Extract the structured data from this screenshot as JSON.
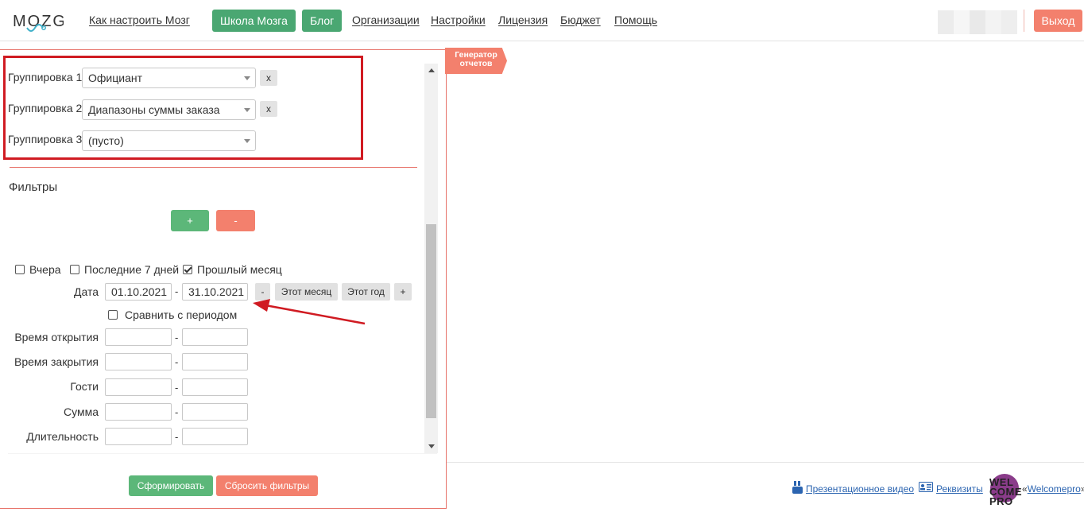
{
  "header": {
    "logo_text": "MOZG",
    "nav_links": [
      "Как настроить Мозг",
      "Организации",
      "Настройки",
      "Лицензия",
      "Бюджет",
      "Помощь"
    ],
    "nav_buttons": [
      "Школа Мозга",
      "Блог"
    ],
    "logout_label": "Выход"
  },
  "panel": {
    "tab_label_line1": "Генератор",
    "tab_label_line2": "отчетов",
    "groupings": [
      {
        "label": "Группировка 1",
        "value": "Официант",
        "remove": "x"
      },
      {
        "label": "Группировка 2",
        "value": "Диапазоны суммы заказа",
        "remove": "x"
      },
      {
        "label": "Группировка 3",
        "value": "(пусто)"
      }
    ],
    "filters_title": "Фильтры",
    "add_filter": "+",
    "remove_filter": "-",
    "quick_periods": [
      {
        "label": "Вчера",
        "checked": false
      },
      {
        "label": "Последние 7 дней",
        "checked": false
      },
      {
        "label": "Прошлый месяц",
        "checked": true
      }
    ],
    "date": {
      "label": "Дата",
      "from": "01.10.2021",
      "to": "31.10.2021",
      "separator": "-",
      "minus": "-",
      "this_month": "Этот месяц",
      "this_year": "Этот год",
      "plus": "+"
    },
    "compare_label": "Сравнить с периодом",
    "range_fields": [
      {
        "label": "Время открытия",
        "from": "",
        "to": ""
      },
      {
        "label": "Время закрытия",
        "from": "",
        "to": ""
      },
      {
        "label": "Гости",
        "from": "",
        "to": ""
      },
      {
        "label": "Сумма",
        "from": "",
        "to": ""
      },
      {
        "label": "Длительность",
        "from": "",
        "to": ""
      }
    ],
    "submit_label": "Сформировать",
    "reset_label": "Сбросить фильтры"
  },
  "footer": {
    "video_link": "Презентационное видео",
    "requisites_link": "Реквизиты",
    "wc_line1": "WEL",
    "wc_line2": "COME",
    "wc_line3": "PRO",
    "partner_prefix": "«",
    "partner_name": "Welcomepro",
    "partner_suffix": "»"
  },
  "colors": {
    "green": "#4aa772",
    "salmon": "#f3806d",
    "highlight": "#d01b22",
    "link": "#2b64b0"
  }
}
